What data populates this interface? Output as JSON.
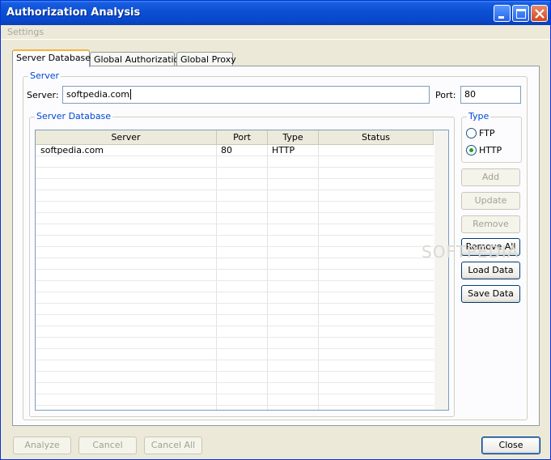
{
  "window": {
    "title": "Authorization Analysis",
    "controls": {
      "minimize_icon": "minimize-icon",
      "maximize_icon": "maximize-icon",
      "close_icon": "close-icon"
    }
  },
  "menu": {
    "items": [
      "Settings"
    ]
  },
  "tabs": [
    {
      "label": "Server Database",
      "active": true
    },
    {
      "label": "Global Authorization",
      "active": false
    },
    {
      "label": "Global Proxy",
      "active": false
    }
  ],
  "server_group": {
    "title": "Server",
    "server_label": "Server:",
    "server_value": "softpedia.com",
    "port_label": "Port:",
    "port_value": "80"
  },
  "database_group": {
    "title": "Server Database",
    "columns": [
      "Server",
      "Port",
      "Type",
      "Status"
    ],
    "rows": [
      {
        "server": "softpedia.com",
        "port": "80",
        "type": "HTTP",
        "status": ""
      }
    ]
  },
  "type_group": {
    "title": "Type",
    "options": [
      {
        "label": "FTP",
        "checked": false
      },
      {
        "label": "HTTP",
        "checked": true
      }
    ]
  },
  "side_buttons": {
    "add": "Add",
    "update": "Update",
    "remove": "Remove",
    "remove_all": "Remove All",
    "load_data": "Load Data",
    "save_data": "Save Data"
  },
  "bottom_buttons": {
    "analyze": "Analyze",
    "cancel": "Cancel",
    "cancel_all": "Cancel All",
    "close": "Close"
  },
  "watermark": "SOFTPEDIA",
  "colors": {
    "title_bar": "#0a4fd4",
    "group_title": "#0046d5",
    "active_tab_accent": "#f8b33a",
    "checked_radio": "#21a121"
  }
}
